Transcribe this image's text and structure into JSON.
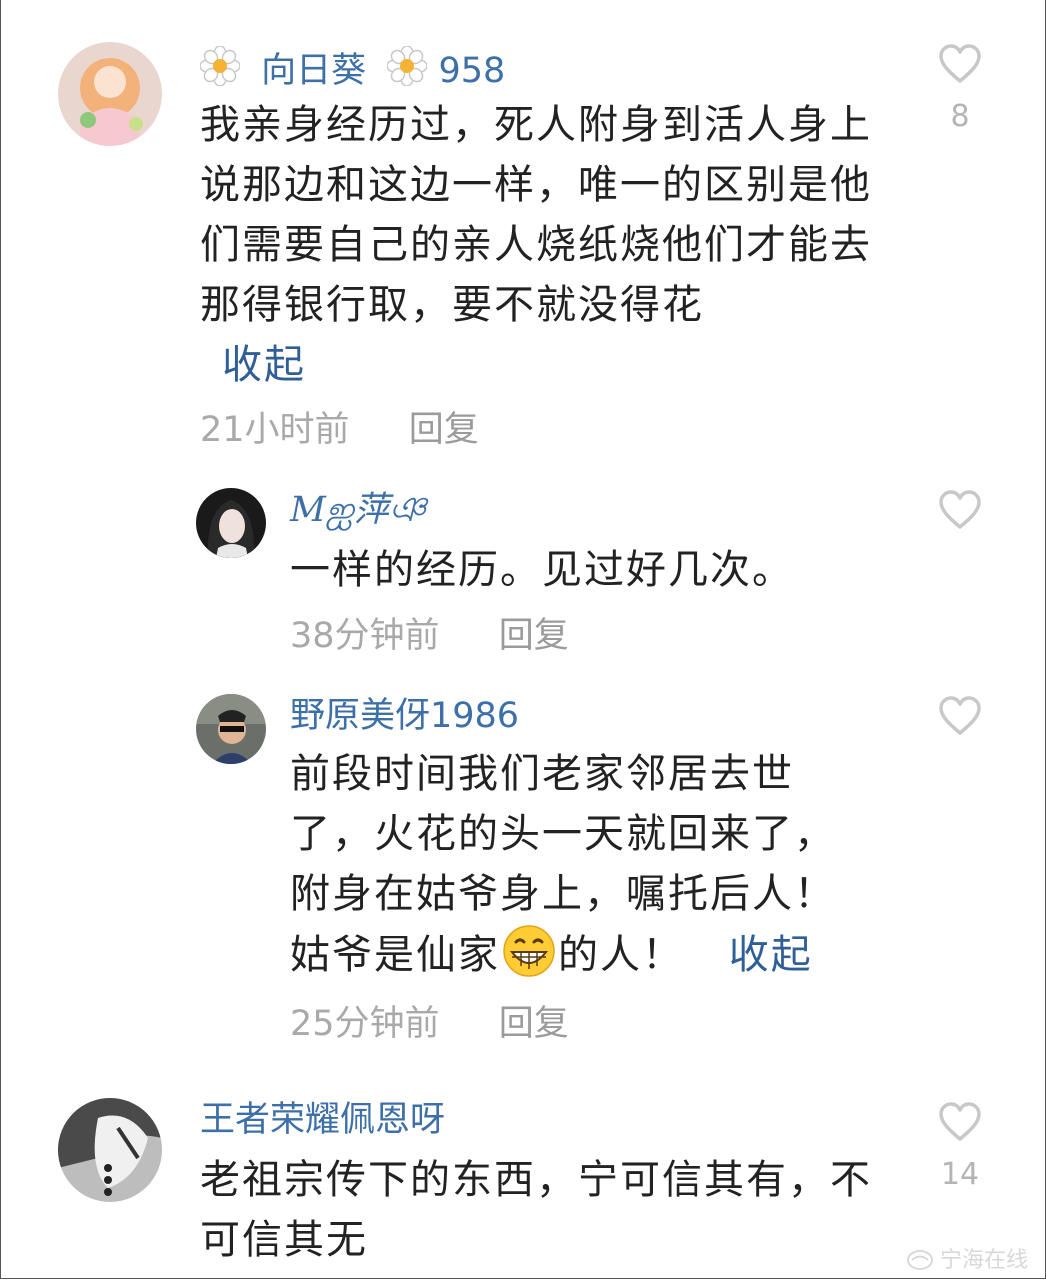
{
  "comments": [
    {
      "username": "向日葵 958",
      "username_prefix": "向日葵",
      "username_suffix": "958",
      "text": "我亲身经历过，死人附身到活人身上说那边和这边一样，唯一的区别是他们需要自己的亲人烧纸烧他们才能去那得银行取，要不就没得花",
      "collapse_label": "收起",
      "time": "21小时前",
      "reply_label": "回复",
      "likes": "8"
    },
    {
      "username": "Mஐ萍ঞ",
      "text": "一样的经历。见过好几次。",
      "time": "38分钟前",
      "reply_label": "回复"
    },
    {
      "username": "野原美伢1986",
      "text_before_emoji": "前段时间我们老家邻居去世了，火花的头一天就回来了，附身在姑爷身上，嘱托后人！姑爷是仙家",
      "emoji": "grinning-face-emoji",
      "text_after_emoji": "的人！",
      "collapse_label": "收起",
      "time": "25分钟前",
      "reply_label": "回复"
    },
    {
      "username": "王者荣耀佩恩呀",
      "text": "老祖宗传下的东西，宁可信其有，不可信其无",
      "likes": "14"
    }
  ],
  "watermark": "宁海在线",
  "icons": {
    "like": "heart-outline-icon",
    "username_decoration": "flower-icon"
  },
  "colors": {
    "username": "#3d6fa8",
    "collapse": "#2f5f96",
    "meta": "#a9a9a9",
    "body_text": "#222222",
    "heart": "#c8c8c8"
  }
}
